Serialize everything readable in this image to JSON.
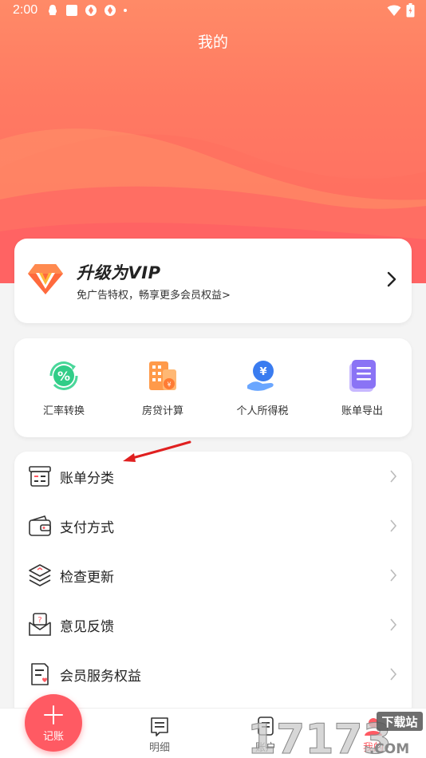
{
  "status_bar": {
    "time": "2:00"
  },
  "header": {
    "title": "我的"
  },
  "vip": {
    "title": "升级为VIP",
    "subtitle": "免广告特权，畅享更多会员权益>"
  },
  "tools": [
    {
      "label": "汇率转换",
      "icon": "exchange-rate-icon"
    },
    {
      "label": "房贷计算",
      "icon": "mortgage-calculator-icon"
    },
    {
      "label": "个人所得税",
      "icon": "income-tax-icon"
    },
    {
      "label": "账单导出",
      "icon": "bill-export-icon"
    }
  ],
  "menu": [
    {
      "label": "账单分类",
      "icon": "bill-category-icon"
    },
    {
      "label": "支付方式",
      "icon": "wallet-icon"
    },
    {
      "label": "检查更新",
      "icon": "layers-icon"
    },
    {
      "label": "意见反馈",
      "icon": "feedback-envelope-icon"
    },
    {
      "label": "会员服务权益",
      "icon": "member-document-icon"
    }
  ],
  "fab": {
    "label": "记账"
  },
  "tabbar": [
    {
      "label": "明细",
      "icon": "detail-list-icon"
    },
    {
      "label": "账户",
      "icon": "account-icon"
    },
    {
      "label": "我的",
      "icon": "profile-icon"
    }
  ],
  "watermark": {
    "brand_number": "17173",
    "site_label": "下载站",
    "domain": ".COM"
  },
  "colors": {
    "accent": "#ff5a63",
    "hero_top": "#ff8a67",
    "hero_bottom": "#ff6a63"
  }
}
